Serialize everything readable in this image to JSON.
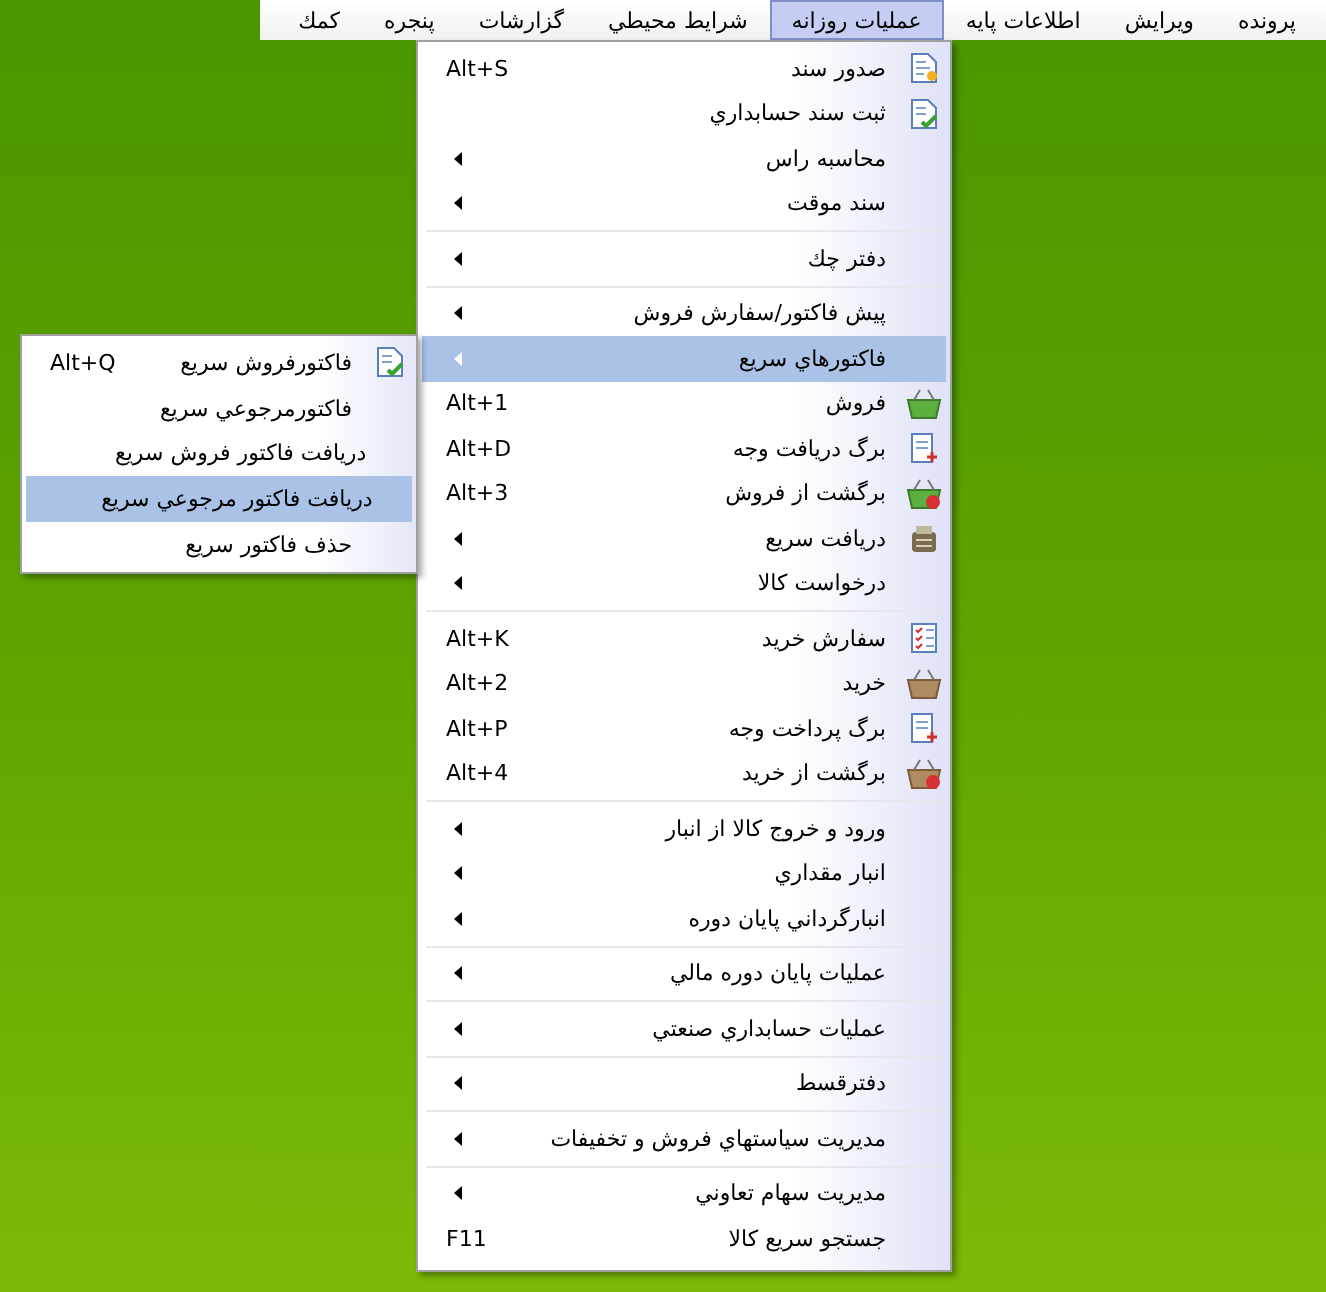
{
  "menubar": [
    {
      "label": "پرونده",
      "selected": false
    },
    {
      "label": "ويرايش",
      "selected": false
    },
    {
      "label": "اطلاعات پایه",
      "selected": false
    },
    {
      "label": "عمليات روزانه",
      "selected": true
    },
    {
      "label": "شرايط محيطي",
      "selected": false
    },
    {
      "label": "گزارشات",
      "selected": false
    },
    {
      "label": "پنجره",
      "selected": false
    },
    {
      "label": "كمك",
      "selected": false
    }
  ],
  "menu": {
    "groups": [
      [
        {
          "label": "صدور سند",
          "shortcut": "Alt+S",
          "kind": "document",
          "selected": false
        },
        {
          "label": "ثبت سند حسابداري",
          "kind": "document-check",
          "selected": false
        },
        {
          "label": "محاسبه راس",
          "submenu": true,
          "selected": false
        },
        {
          "label": "سند موقت",
          "submenu": true,
          "selected": false
        }
      ],
      [
        {
          "label": "دفتر چك",
          "submenu": true,
          "selected": false
        }
      ],
      [
        {
          "label": "پيش فاكتور/سفارش فروش",
          "submenu": true,
          "selected": false
        },
        {
          "label": "فاكتورهاي سريع",
          "submenu": true,
          "selected": true
        },
        {
          "label": "فروش",
          "shortcut": "Alt+1",
          "kind": "basket",
          "selected": false
        },
        {
          "label": "برگ دريافت وجه",
          "shortcut": "Alt+D",
          "kind": "document-plus",
          "selected": false
        },
        {
          "label": "برگشت از فروش",
          "shortcut": "Alt+3",
          "kind": "basket-return",
          "selected": false
        },
        {
          "label": "دريافت سريع",
          "kind": "register",
          "submenu": true,
          "selected": false
        },
        {
          "label": "درخواست كالا",
          "submenu": true,
          "selected": false
        }
      ],
      [
        {
          "label": "سفارش خريد",
          "shortcut": "Alt+K",
          "kind": "checklist",
          "selected": false
        },
        {
          "label": "خريد",
          "shortcut": "Alt+2",
          "kind": "basket-brown",
          "selected": false
        },
        {
          "label": "برگ پرداخت وجه",
          "shortcut": "Alt+P",
          "kind": "document-plus",
          "selected": false
        },
        {
          "label": "برگشت از خريد",
          "shortcut": "Alt+4",
          "kind": "basket-brown-return",
          "selected": false
        }
      ],
      [
        {
          "label": "ورود و خروج كالا از انبار",
          "submenu": true,
          "selected": false
        },
        {
          "label": "انبار مقداري",
          "submenu": true,
          "selected": false
        },
        {
          "label": "انبارگرداني پايان دوره",
          "submenu": true,
          "selected": false
        }
      ],
      [
        {
          "label": "عمليات پايان دوره مالي",
          "submenu": true,
          "selected": false
        }
      ],
      [
        {
          "label": "عمليات حسابداري صنعتي",
          "submenu": true,
          "selected": false
        }
      ],
      [
        {
          "label": "دفترقسط",
          "submenu": true,
          "selected": false
        }
      ],
      [
        {
          "label": "مديريت سياستهاي فروش و تخفيفات",
          "submenu": true,
          "selected": false
        }
      ],
      [
        {
          "label": "مديريت سهام تعاوني",
          "submenu": true,
          "selected": false
        },
        {
          "label": "جستجو سريع كالا",
          "shortcut": "F11",
          "selected": false
        }
      ]
    ]
  },
  "submenu": {
    "items": [
      {
        "label": "فاكتورفروش سريع",
        "shortcut": "Alt+Q",
        "kind": "document-check",
        "selected": false
      },
      {
        "label": "فاكتورمرجوعي سريع",
        "selected": false
      },
      {
        "label": "دريافت فاكتور فروش سريع",
        "selected": false
      },
      {
        "label": "دريافت فاكتور مرجوعي سريع",
        "selected": true
      },
      {
        "label": "حذف فاكتور سريع",
        "selected": false
      }
    ]
  }
}
